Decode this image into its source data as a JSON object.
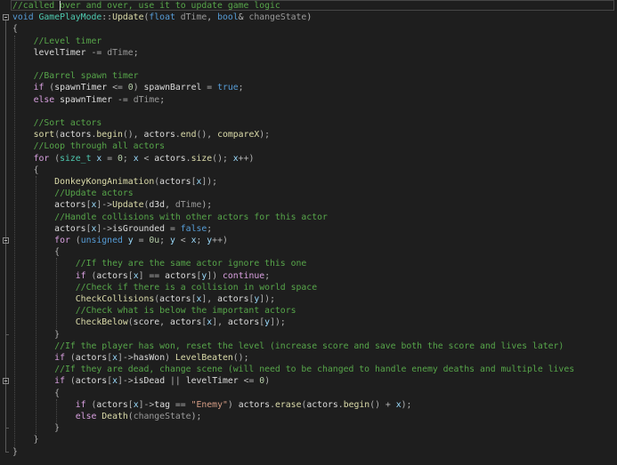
{
  "editor": {
    "lines": [
      [
        [
          "c",
          "//called over and over, use it to update game logic"
        ]
      ],
      [
        [
          "t",
          "void "
        ],
        [
          "n",
          "GamePlayMode"
        ],
        [
          "o",
          "::"
        ],
        [
          "f",
          "Update"
        ],
        [
          "o",
          "("
        ],
        [
          "t",
          "float "
        ],
        [
          "p",
          "dTime"
        ],
        [
          "o",
          ", "
        ],
        [
          "t",
          "bool"
        ],
        [
          "o",
          "& "
        ],
        [
          "p",
          "changeState"
        ],
        [
          "o",
          ")"
        ]
      ],
      [
        [
          "o",
          "{"
        ]
      ],
      [
        [
          "d",
          "    "
        ],
        [
          "c",
          "//Level timer"
        ]
      ],
      [
        [
          "d",
          "    levelTimer "
        ],
        [
          "o",
          "-= "
        ],
        [
          "p",
          "dTime"
        ],
        [
          "o",
          ";"
        ]
      ],
      [],
      [
        [
          "d",
          "    "
        ],
        [
          "c",
          "//Barrel spawn timer"
        ]
      ],
      [
        [
          "k",
          "    if "
        ],
        [
          "o",
          "("
        ],
        [
          "d",
          "spawnTimer "
        ],
        [
          "o",
          "<= "
        ],
        [
          "num",
          "0"
        ],
        [
          "o",
          ") "
        ],
        [
          "d",
          "spawnBarrel "
        ],
        [
          "o",
          "= "
        ],
        [
          "t",
          "true"
        ],
        [
          "o",
          ";"
        ]
      ],
      [
        [
          "k",
          "    else "
        ],
        [
          "d",
          "spawnTimer "
        ],
        [
          "o",
          "-= "
        ],
        [
          "p",
          "dTime"
        ],
        [
          "o",
          ";"
        ]
      ],
      [],
      [
        [
          "d",
          "    "
        ],
        [
          "c",
          "//Sort actors"
        ]
      ],
      [
        [
          "f",
          "    sort"
        ],
        [
          "o",
          "("
        ],
        [
          "d",
          "actors"
        ],
        [
          "o",
          "."
        ],
        [
          "f",
          "begin"
        ],
        [
          "o",
          "(), "
        ],
        [
          "d",
          "actors"
        ],
        [
          "o",
          "."
        ],
        [
          "f",
          "end"
        ],
        [
          "o",
          "(), "
        ],
        [
          "f",
          "compareX"
        ],
        [
          "o",
          ");"
        ]
      ],
      [
        [
          "d",
          "    "
        ],
        [
          "c",
          "//Loop through all actors"
        ]
      ],
      [
        [
          "k",
          "    for "
        ],
        [
          "o",
          "("
        ],
        [
          "n",
          "size_t "
        ],
        [
          "v",
          "x "
        ],
        [
          "o",
          "= "
        ],
        [
          "num",
          "0"
        ],
        [
          "o",
          "; "
        ],
        [
          "v",
          "x "
        ],
        [
          "o",
          "< "
        ],
        [
          "d",
          "actors"
        ],
        [
          "o",
          "."
        ],
        [
          "f",
          "size"
        ],
        [
          "o",
          "(); "
        ],
        [
          "v",
          "x"
        ],
        [
          "o",
          "++)"
        ]
      ],
      [
        [
          "o",
          "    {"
        ]
      ],
      [
        [
          "f",
          "        DonkeyKongAnimation"
        ],
        [
          "o",
          "("
        ],
        [
          "d",
          "actors"
        ],
        [
          "o",
          "["
        ],
        [
          "v",
          "x"
        ],
        [
          "o",
          "]);"
        ]
      ],
      [
        [
          "d",
          "        "
        ],
        [
          "c",
          "//Update actors"
        ]
      ],
      [
        [
          "d",
          "        actors"
        ],
        [
          "o",
          "["
        ],
        [
          "v",
          "x"
        ],
        [
          "o",
          "]->"
        ],
        [
          "f",
          "Update"
        ],
        [
          "o",
          "("
        ],
        [
          "d",
          "d3d"
        ],
        [
          "o",
          ", "
        ],
        [
          "p",
          "dTime"
        ],
        [
          "o",
          ");"
        ]
      ],
      [
        [
          "d",
          "        "
        ],
        [
          "c",
          "//Handle collisions with other actors for this actor"
        ]
      ],
      [
        [
          "d",
          "        actors"
        ],
        [
          "o",
          "["
        ],
        [
          "v",
          "x"
        ],
        [
          "o",
          "]->"
        ],
        [
          "d",
          "isGrounded "
        ],
        [
          "o",
          "= "
        ],
        [
          "t",
          "false"
        ],
        [
          "o",
          ";"
        ]
      ],
      [
        [
          "k",
          "        for "
        ],
        [
          "o",
          "("
        ],
        [
          "t",
          "unsigned "
        ],
        [
          "v",
          "y "
        ],
        [
          "o",
          "= "
        ],
        [
          "num",
          "0u"
        ],
        [
          "o",
          "; "
        ],
        [
          "v",
          "y "
        ],
        [
          "o",
          "< "
        ],
        [
          "v",
          "x"
        ],
        [
          "o",
          "; "
        ],
        [
          "v",
          "y"
        ],
        [
          "o",
          "++)"
        ]
      ],
      [
        [
          "o",
          "        {"
        ]
      ],
      [
        [
          "d",
          "            "
        ],
        [
          "c",
          "//If they are the same actor ignore this one"
        ]
      ],
      [
        [
          "k",
          "            if "
        ],
        [
          "o",
          "("
        ],
        [
          "d",
          "actors"
        ],
        [
          "o",
          "["
        ],
        [
          "v",
          "x"
        ],
        [
          "o",
          "] == "
        ],
        [
          "d",
          "actors"
        ],
        [
          "o",
          "["
        ],
        [
          "v",
          "y"
        ],
        [
          "o",
          "]) "
        ],
        [
          "k",
          "continue"
        ],
        [
          "o",
          ";"
        ]
      ],
      [
        [
          "d",
          "            "
        ],
        [
          "c",
          "//Check if there is a collision in world space"
        ]
      ],
      [
        [
          "f",
          "            CheckCollisions"
        ],
        [
          "o",
          "("
        ],
        [
          "d",
          "actors"
        ],
        [
          "o",
          "["
        ],
        [
          "v",
          "x"
        ],
        [
          "o",
          "], "
        ],
        [
          "d",
          "actors"
        ],
        [
          "o",
          "["
        ],
        [
          "v",
          "y"
        ],
        [
          "o",
          "]);"
        ]
      ],
      [
        [
          "d",
          "            "
        ],
        [
          "c",
          "//Check what is below the important actors"
        ]
      ],
      [
        [
          "f",
          "            CheckBelow"
        ],
        [
          "o",
          "("
        ],
        [
          "d",
          "score"
        ],
        [
          "o",
          ", "
        ],
        [
          "d",
          "actors"
        ],
        [
          "o",
          "["
        ],
        [
          "v",
          "x"
        ],
        [
          "o",
          "], "
        ],
        [
          "d",
          "actors"
        ],
        [
          "o",
          "["
        ],
        [
          "v",
          "y"
        ],
        [
          "o",
          "]);"
        ]
      ],
      [
        [
          "o",
          "        }"
        ]
      ],
      [
        [
          "d",
          "        "
        ],
        [
          "c",
          "//If the player has won, reset the level (increase score and save both the score and lives later)"
        ]
      ],
      [
        [
          "k",
          "        if "
        ],
        [
          "o",
          "("
        ],
        [
          "d",
          "actors"
        ],
        [
          "o",
          "["
        ],
        [
          "v",
          "x"
        ],
        [
          "o",
          "]->"
        ],
        [
          "d",
          "hasWon"
        ],
        [
          "o",
          ") "
        ],
        [
          "f",
          "LevelBeaten"
        ],
        [
          "o",
          "();"
        ]
      ],
      [
        [
          "d",
          "        "
        ],
        [
          "c",
          "//If they are dead, change scene (will need to be changed to handle enemy deaths and multiple lives"
        ]
      ],
      [
        [
          "k",
          "        if "
        ],
        [
          "o",
          "("
        ],
        [
          "d",
          "actors"
        ],
        [
          "o",
          "["
        ],
        [
          "v",
          "x"
        ],
        [
          "o",
          "]->"
        ],
        [
          "d",
          "isDead "
        ],
        [
          "o",
          "|| "
        ],
        [
          "d",
          "levelTimer "
        ],
        [
          "o",
          "<= "
        ],
        [
          "num",
          "0"
        ],
        [
          "o",
          ")"
        ]
      ],
      [
        [
          "o",
          "        {"
        ]
      ],
      [
        [
          "k",
          "            if "
        ],
        [
          "o",
          "("
        ],
        [
          "d",
          "actors"
        ],
        [
          "o",
          "["
        ],
        [
          "v",
          "x"
        ],
        [
          "o",
          "]->"
        ],
        [
          "d",
          "tag "
        ],
        [
          "o",
          "== "
        ],
        [
          "s",
          "\"Enemy\""
        ],
        [
          "o",
          ") "
        ],
        [
          "d",
          "actors"
        ],
        [
          "o",
          "."
        ],
        [
          "f",
          "erase"
        ],
        [
          "o",
          "("
        ],
        [
          "d",
          "actors"
        ],
        [
          "o",
          "."
        ],
        [
          "f",
          "begin"
        ],
        [
          "o",
          "() + "
        ],
        [
          "v",
          "x"
        ],
        [
          "o",
          ");"
        ]
      ],
      [
        [
          "k",
          "            else "
        ],
        [
          "f",
          "Death"
        ],
        [
          "o",
          "("
        ],
        [
          "p",
          "changeState"
        ],
        [
          "o",
          ");"
        ]
      ],
      [
        [
          "o",
          "        }"
        ]
      ],
      [
        [
          "o",
          "    }"
        ]
      ],
      [
        [
          "o",
          "}"
        ]
      ]
    ]
  },
  "theme": {
    "background": "#1e1e1e",
    "comment": "#57a64a",
    "keyword": "#d8a0df",
    "type": "#569cd6"
  }
}
